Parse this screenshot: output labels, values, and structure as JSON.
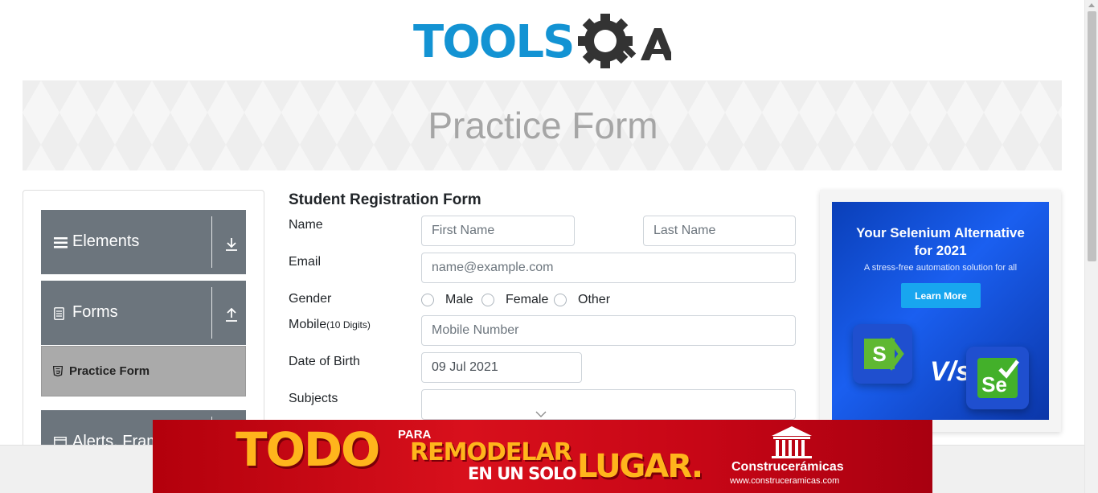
{
  "logo": {
    "tools": "TOOLS",
    "qa": "QA",
    "colors": {
      "tools": "#1393d3",
      "qa": "#333333"
    }
  },
  "banner": {
    "title": "Practice Form"
  },
  "sidebar": {
    "groups": [
      {
        "label": "Elements",
        "icon": "hamburger-icon",
        "arrow": "download-arrow-icon"
      },
      {
        "label": "Forms",
        "icon": "document-icon",
        "arrow": "upload-arrow-icon"
      },
      {
        "label": "Alerts, Frame & Windows",
        "icon": "window-icon",
        "arrow": "download-arrow-icon"
      }
    ],
    "active_item": {
      "label": "Practice Form",
      "icon": "html5-icon"
    },
    "colors": {
      "group_bg": "#6c757d",
      "active_bg": "#aaaaaa"
    }
  },
  "form": {
    "title": "Student Registration Form",
    "name_label": "Name",
    "first_name_placeholder": "First Name",
    "last_name_placeholder": "Last Name",
    "email_label": "Email",
    "email_placeholder": "name@example.com",
    "gender_label": "Gender",
    "gender_options": [
      "Male",
      "Female",
      "Other"
    ],
    "mobile_label": "Mobile",
    "mobile_hint": "(10 Digits)",
    "mobile_placeholder": "Mobile Number",
    "dob_label": "Date of Birth",
    "dob_value": "09 Jul 2021",
    "subjects_label": "Subjects",
    "subjects_value": ""
  },
  "side_ad": {
    "title_line1": "Your Selenium Alternative",
    "title_line2": "for 2021",
    "subtitle": "A stress-free automation solution for all",
    "button": "Learn More",
    "vs": "V/s",
    "left_logo": "S",
    "right_logo": "Se"
  },
  "bottom_ad": {
    "todo": "TODO",
    "para": "PARA",
    "remodelar": "REMODELAR",
    "en_un_solo": "EN UN SOLO",
    "lugar": "LUGAR.",
    "brand": "Construcerámicas",
    "url": "www.construceramicas.com"
  }
}
